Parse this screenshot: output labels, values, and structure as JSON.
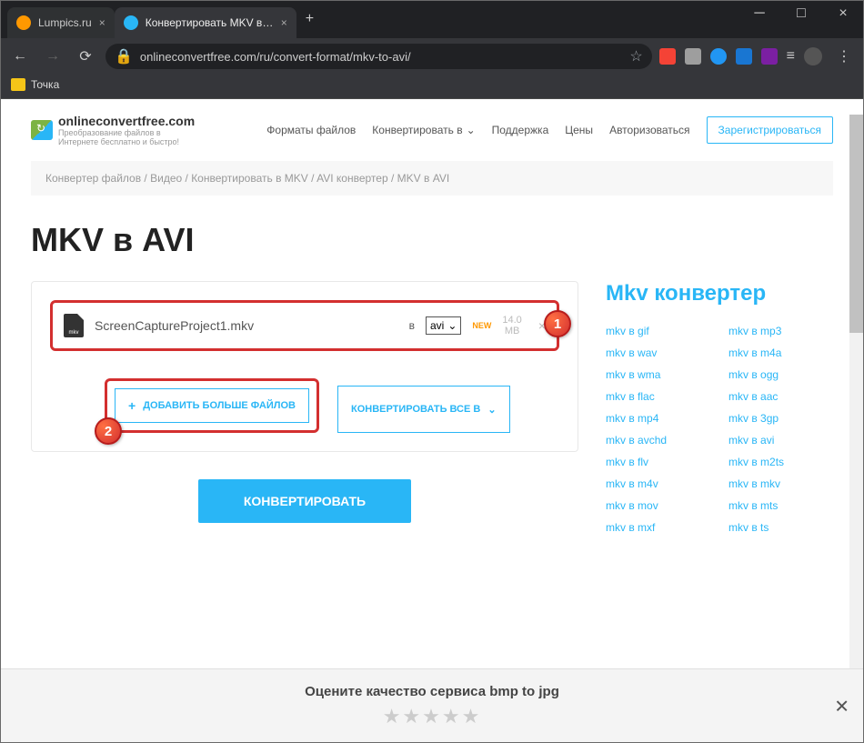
{
  "browser": {
    "tabs": [
      {
        "title": "Lumpics.ru",
        "active": false
      },
      {
        "title": "Конвертировать MKV в AVI онл",
        "active": true
      }
    ],
    "url": "onlineconvertfree.com/ru/convert-format/mkv-to-avi/",
    "bookmark": "Точка"
  },
  "header": {
    "logo_title": "onlineconvertfree.com",
    "logo_sub": "Преобразование файлов в Интернете бесплатно и быстро!",
    "nav": {
      "formats": "Форматы файлов",
      "convert": "Конвертировать в",
      "support": "Поддержка",
      "pricing": "Цены",
      "login": "Авторизоваться",
      "signup": "Зарегистрироваться"
    }
  },
  "breadcrumbs": {
    "c1": "Конвертер файлов",
    "c2": "Видео",
    "c3": "Конвертировать в MKV",
    "c4": "AVI конвертер",
    "c5": "MKV в AVI"
  },
  "title": "MKV в AVI",
  "file": {
    "icon_label": "mkv",
    "name": "ScreenCaptureProject1.mkv",
    "to": "в",
    "format": "avi",
    "new": "NEW",
    "size_a": "14.0",
    "size_b": "MB"
  },
  "actions": {
    "add_more": "ДОБАВИТЬ БОЛЬШЕ ФАЙЛОВ",
    "convert_all": "КОНВЕРТИРОВАТЬ ВСЕ В",
    "convert": "КОНВЕРТИРОВАТЬ"
  },
  "markers": {
    "m1": "1",
    "m2": "2"
  },
  "sidebar": {
    "title": "Mkv конвертер",
    "links": [
      "mkv в gif",
      "mkv в mp3",
      "mkv в wav",
      "mkv в m4a",
      "mkv в wma",
      "mkv в ogg",
      "mkv в flac",
      "mkv в aac",
      "mkv в mp4",
      "mkv в 3gp",
      "mkv в avchd",
      "mkv в avi",
      "mkv в flv",
      "mkv в m2ts",
      "mkv в m4v",
      "mkv в mkv",
      "mkv в mov",
      "mkv в mts",
      "mkv в mxf",
      "mkv в ts"
    ]
  },
  "rating": {
    "text": "Оцените качество сервиса bmp to jpg"
  }
}
